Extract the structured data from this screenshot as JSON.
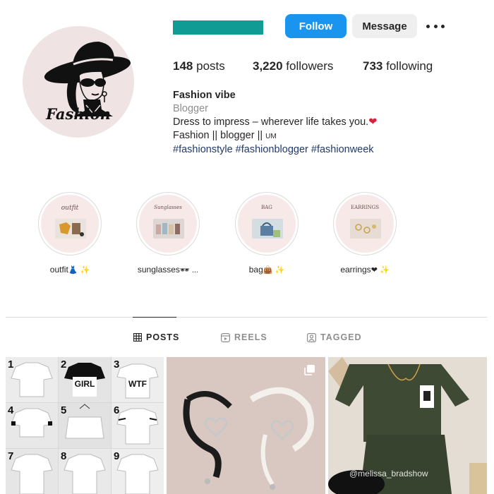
{
  "profile": {
    "follow_label": "Follow",
    "message_label": "Message",
    "avatar_text": "Fashion",
    "stats": {
      "posts_count": "148",
      "posts_label": "posts",
      "followers_count": "3,220",
      "followers_label": "followers",
      "following_count": "733",
      "following_label": "following"
    },
    "bio": {
      "name": "Fashion vibe",
      "category": "Blogger",
      "line1": "Dress to impress – wherever life takes you.",
      "line2": "Fashion || blogger || ",
      "line2_small": "UM",
      "hashtags": "#fashionstyle #fashionblogger #fashionweek"
    }
  },
  "highlights": [
    {
      "cover_title": "outfit",
      "label": "outfit",
      "emoji": "👗 ✨"
    },
    {
      "cover_title": "Sunglasses",
      "label": "sunglasses",
      "emoji": "🕶 ..."
    },
    {
      "cover_title": "BAG",
      "label": "bag",
      "emoji": "👜 ✨"
    },
    {
      "cover_title": "EARRINGS",
      "label": "earrings",
      "emoji": "❤ ✨"
    }
  ],
  "tabs": {
    "posts": "POSTS",
    "reels": "REELS",
    "tagged": "TAGGED"
  },
  "posts": {
    "tee_numbers": [
      "1",
      "2",
      "3",
      "4",
      "5",
      "6",
      "7",
      "8",
      "9"
    ],
    "tee_texts": [
      "GIRL",
      "WTF"
    ],
    "watermark": "@melissa_bradshow"
  },
  "colors": {
    "accent": "#1a95ef",
    "username_bar": "#119b95"
  }
}
